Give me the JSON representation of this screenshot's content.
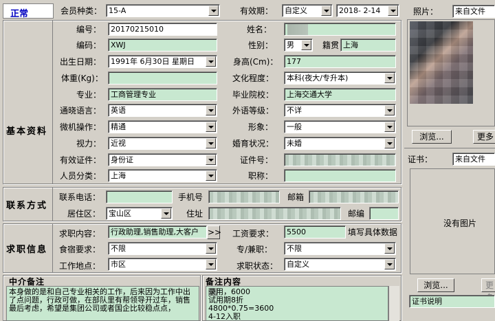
{
  "status": "正常",
  "top": {
    "member_type_label": "会员种类：",
    "member_type_value": "15-A",
    "validity_label": "有效期：",
    "validity_value": "自定义",
    "validity_date": "2018- 2-14"
  },
  "basic": {
    "section_label": "基本资料",
    "code_label": "编号：",
    "code_value": "20170215010",
    "name_label": "姓名：",
    "name_value": "",
    "code2_label": "编码：",
    "code2_value": "XWJ",
    "gender_label": "性别：",
    "gender_value": "男",
    "native_label": "籍贯",
    "native_value": "上海",
    "birth_label": "出生日期：",
    "birth_value": "1991年 6月30日 星期日",
    "height_label": "身高(Cm)：",
    "height_value": "177",
    "weight_label": "体重(Kg)：",
    "weight_value": "",
    "edu_label": "文化程度：",
    "edu_value": "本科(夜大/专升本)",
    "major_label": "专业：",
    "major_value": "工商管理专业",
    "school_label": "毕业院校：",
    "school_value": "上海交通大学",
    "lang_label": "通晓语言：",
    "lang_value": "英语",
    "lang_level_label": "外语等级：",
    "lang_level_value": "不详",
    "pc_label": "微机操作：",
    "pc_value": "精通",
    "image_label": "形象：",
    "image_value": "一般",
    "vision_label": "视力：",
    "vision_value": "近视",
    "marital_label": "婚育状况：",
    "marital_value": "未婚",
    "id_type_label": "有效证件：",
    "id_type_value": "身份证",
    "id_no_label": "证件号：",
    "id_no_value": "",
    "category_label": "人员分类：",
    "category_value": "上海",
    "title_label": "职称：",
    "title_value": ""
  },
  "contact": {
    "section_label": "联系方式",
    "phone_label": "联系电话：",
    "phone_value": "",
    "mobile_label": "手机号",
    "mobile_value": "",
    "email_label": "邮箱",
    "email_value": "",
    "district_label": "居住区：",
    "district_value": "宝山区",
    "address_label": "住址",
    "address_value": "",
    "zip_label": "邮编",
    "zip_value": ""
  },
  "job": {
    "section_label": "求职信息",
    "content_label": "求职内容：",
    "content_value": "行政助理,销售助理,大客户",
    "more_button": ">>",
    "salary_label": "工资要求：",
    "salary_value": "5500",
    "salary_hint": "填写具体数据",
    "meal_label": "食宿要求：",
    "meal_value": "不限",
    "parttime_label": "专/兼职：",
    "parttime_value": "不限",
    "location_label": "工作地点：",
    "location_value": "市区",
    "status_label": "求职状态：",
    "status_value": "自定义"
  },
  "notes": {
    "agency_label": "中介备注",
    "agency_text": "本身做的是和自己专业相关的工作，后来因为工作中出了点问题，行政可做，在部队里有帮领导开过车，销售最后考虑，希望是集团公司或者国企比较稳点点，",
    "remark_label": "备注内容",
    "remark_lines": [
      "   录用，6000",
      "试用期8折",
      "4800*0.75=3600",
      "4-12入职"
    ]
  },
  "side": {
    "photo_label": "照片：",
    "photo_source": "来自文件",
    "browse_button": "浏览...",
    "more_button": "更多",
    "cert_label": "证书：",
    "cert_source": "来自文件",
    "no_image": "没有图片",
    "browse2_button": "浏览...",
    "more2_button": "更多",
    "cert_desc": "证书说明"
  }
}
